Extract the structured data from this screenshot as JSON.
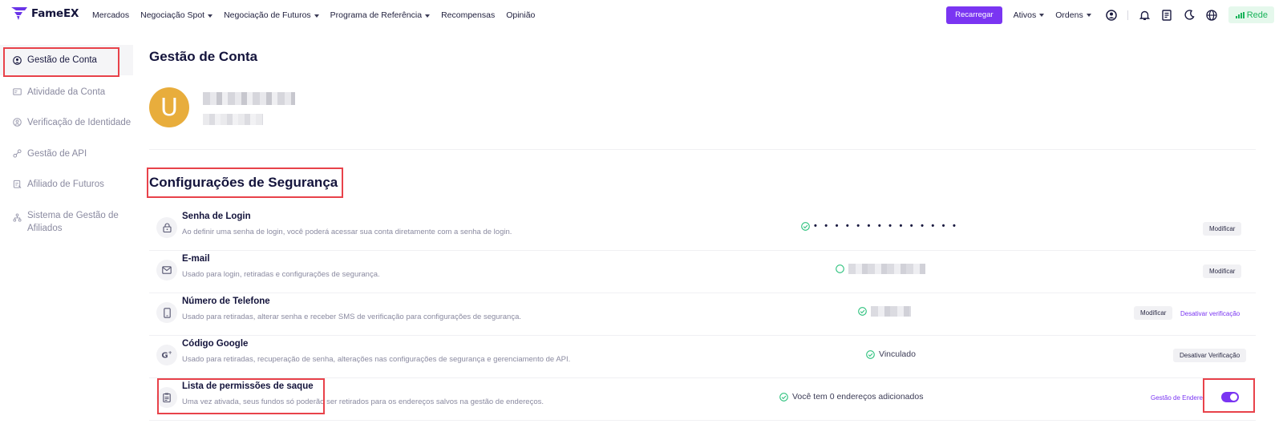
{
  "brand": {
    "name": "FameEX",
    "accent": "#7a35f2"
  },
  "nav": {
    "items": [
      {
        "label": "Mercados",
        "dropdown": false
      },
      {
        "label": "Negociação Spot",
        "dropdown": true
      },
      {
        "label": "Negociação de Futuros",
        "dropdown": true
      },
      {
        "label": "Programa de Referência",
        "dropdown": true
      },
      {
        "label": "Recompensas",
        "dropdown": false
      },
      {
        "label": "Opinião",
        "dropdown": false
      }
    ]
  },
  "toolbar": {
    "recharge_label": "Recarregar",
    "assets_label": "Ativos",
    "orders_label": "Ordens",
    "icons": [
      "user-icon",
      "bell-icon",
      "document-icon",
      "moon-icon",
      "globe-icon"
    ],
    "network_label": "Rede",
    "network_color": "#19b35a"
  },
  "sidebar": {
    "items": [
      {
        "label": "Gestão de Conta",
        "icon": "user-circle-icon",
        "active": true
      },
      {
        "label": "Atividade da Conta",
        "icon": "card-icon",
        "active": false
      },
      {
        "label": "Verificação de Identidade",
        "icon": "id-icon",
        "active": false
      },
      {
        "label": "Gestão de API",
        "icon": "link-icon",
        "active": false
      },
      {
        "label": "Afiliado de Futuros",
        "icon": "clipboard-icon",
        "active": false
      },
      {
        "label": "Sistema de Gestão de Afiliados",
        "icon": "network-icon",
        "active": false
      }
    ]
  },
  "main": {
    "title": "Gestão de Conta",
    "avatar_letter": "U",
    "avatar_color": "#e8ad3c",
    "security_title": "Configurações de Segurança",
    "rows": [
      {
        "title": "Senha de Login",
        "desc": "Ao definir uma senha de login, você poderá acessar sua conta diretamente com a senha de login.",
        "icon": "lock-icon",
        "status": "• • • • • • • • • • • • • •",
        "button": "Modificar"
      },
      {
        "title": "E-mail",
        "desc": "Usado para login, retiradas e configurações de segurança.",
        "icon": "mail-icon",
        "button": "Modificar"
      },
      {
        "title": "Número de Telefone",
        "desc": "Usado para retiradas, alterar senha e receber SMS de verificação para configurações de segurança.",
        "icon": "phone-icon",
        "button": "Modificar",
        "link": "Desativar verificação"
      },
      {
        "title": "Código Google",
        "desc": "Usado para retiradas, recuperação de senha, alterações nas configurações de segurança e gerenciamento de API.",
        "icon": "google-icon",
        "status": "Vinculado",
        "button": "Desativar Verificação"
      },
      {
        "title": "Lista de permissões de saque",
        "desc": "Uma vez ativada, seus fundos só poderão ser retirados para os endereços salvos na gestão de endereços.",
        "icon": "clipboard-list-icon",
        "status": "Você tem 0 endereços adicionados",
        "link": "Gestão de Endereços",
        "toggle_on": true
      }
    ]
  }
}
